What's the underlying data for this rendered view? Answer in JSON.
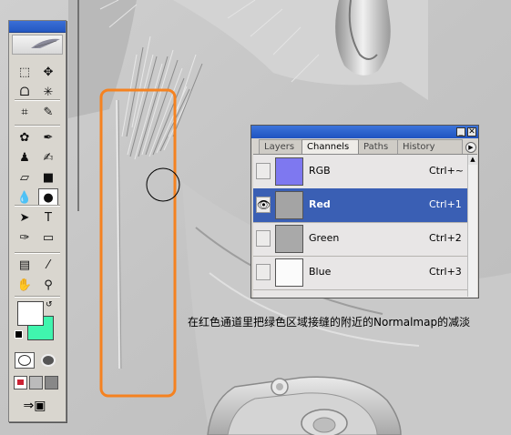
{
  "colors": {
    "highlight_box": "#f58220",
    "palette_title": "#2458c2",
    "selected_row": "#3a5fb4",
    "foreground_swatch": "#ffffff",
    "background_swatch": "#40f5ae"
  },
  "toolbox": {
    "tools": [
      {
        "name": "marquee-tool-icon",
        "glyph": "⬚"
      },
      {
        "name": "move-tool-icon",
        "glyph": "✥"
      },
      {
        "name": "lasso-tool-icon",
        "glyph": "ᗝ"
      },
      {
        "name": "magic-wand-tool-icon",
        "glyph": "✳"
      },
      {
        "name": "crop-tool-icon",
        "glyph": "⌗"
      },
      {
        "name": "slice-tool-icon",
        "glyph": "✎"
      },
      {
        "name": "healing-brush-tool-icon",
        "glyph": "✿"
      },
      {
        "name": "brush-tool-icon",
        "glyph": "✒"
      },
      {
        "name": "clone-stamp-tool-icon",
        "glyph": "♟"
      },
      {
        "name": "history-brush-tool-icon",
        "glyph": "✍"
      },
      {
        "name": "eraser-tool-icon",
        "glyph": "▱"
      },
      {
        "name": "gradient-tool-icon",
        "glyph": "■"
      },
      {
        "name": "blur-tool-icon",
        "glyph": "💧"
      },
      {
        "name": "dodge-tool-icon",
        "glyph": "●"
      },
      {
        "name": "path-selection-tool-icon",
        "glyph": "➤"
      },
      {
        "name": "type-tool-icon",
        "glyph": "T"
      },
      {
        "name": "pen-tool-icon",
        "glyph": "✑"
      },
      {
        "name": "shape-tool-icon",
        "glyph": "▭"
      },
      {
        "name": "notes-tool-icon",
        "glyph": "▤"
      },
      {
        "name": "eyedropper-tool-icon",
        "glyph": "⁄"
      },
      {
        "name": "hand-tool-icon",
        "glyph": "✋"
      },
      {
        "name": "zoom-tool-icon",
        "glyph": "⚲"
      }
    ]
  },
  "channels_panel": {
    "tabs": [
      {
        "label": "Layers"
      },
      {
        "label": "Channels"
      },
      {
        "label": "Paths"
      },
      {
        "label": "History"
      }
    ],
    "channels": [
      {
        "name": "RGB",
        "shortcut": "Ctrl+~",
        "visible": false,
        "selected": false,
        "thumb": "#7e78f0"
      },
      {
        "name": "Red",
        "shortcut": "Ctrl+1",
        "visible": true,
        "selected": true,
        "thumb": "#a4a4a4"
      },
      {
        "name": "Green",
        "shortcut": "Ctrl+2",
        "visible": false,
        "selected": false,
        "thumb": "#a9a9a9"
      },
      {
        "name": "Blue",
        "shortcut": "Ctrl+3",
        "visible": false,
        "selected": false,
        "thumb": "#fbfbfb"
      }
    ]
  },
  "caption": "在红色通道里把绿色区域接缝的附近的Normalmap的减淡"
}
